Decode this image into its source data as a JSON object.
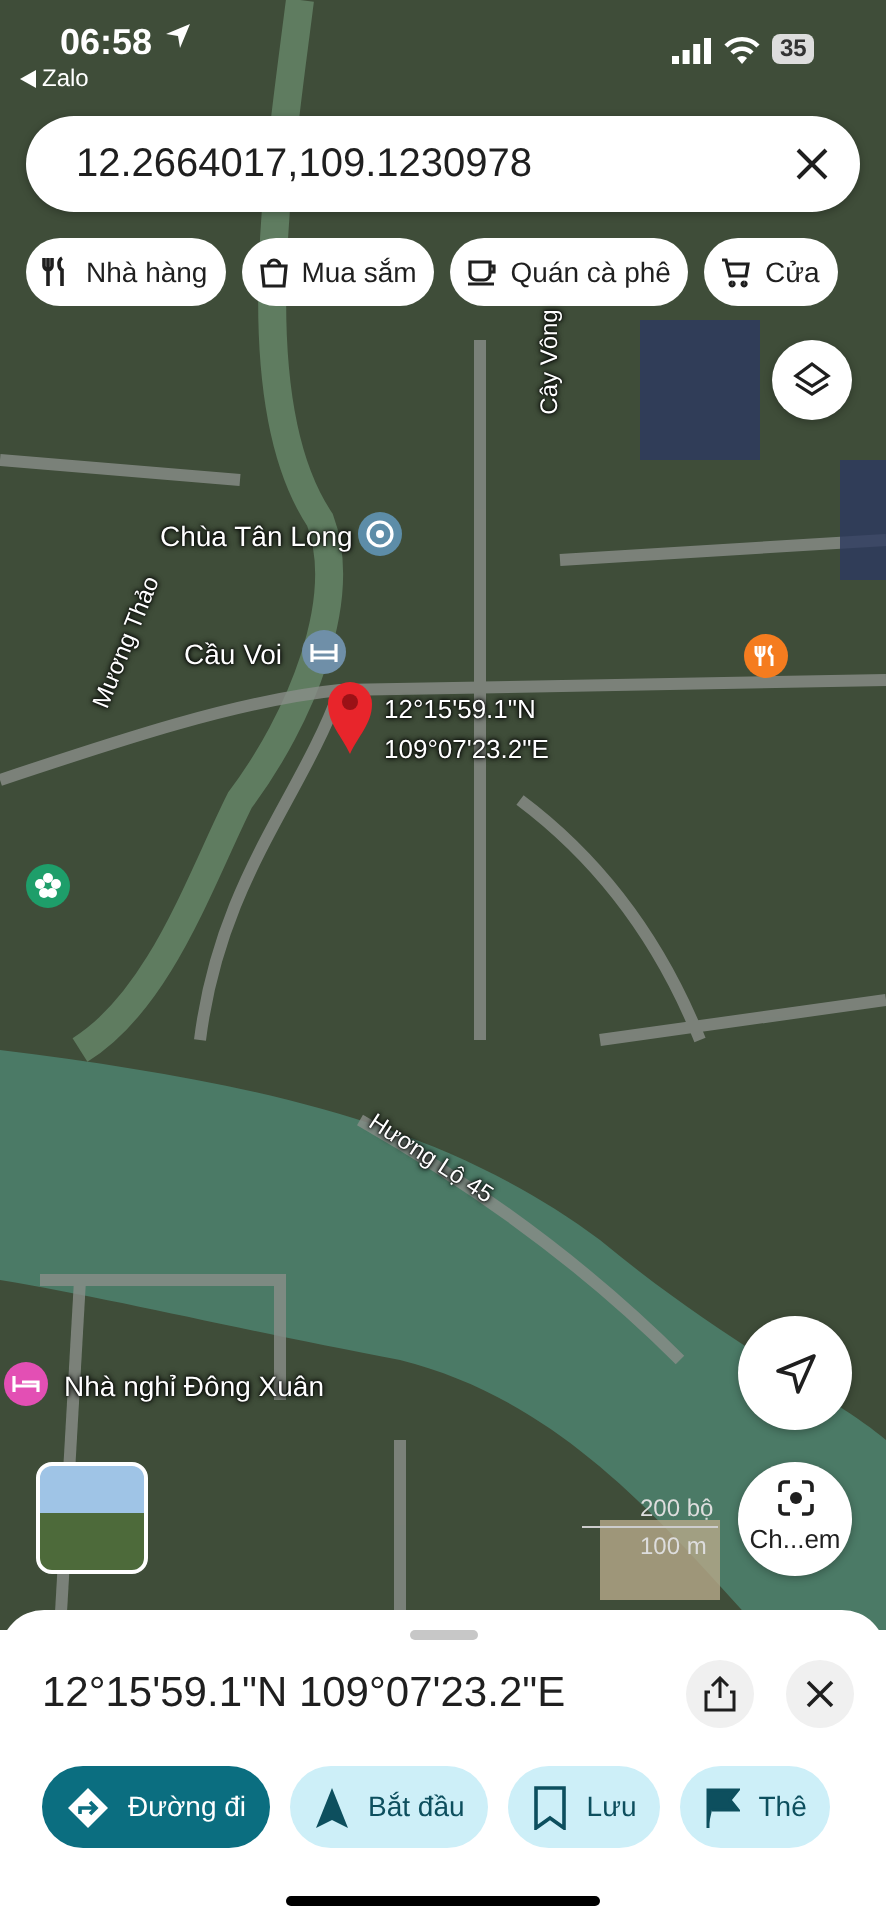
{
  "status_bar": {
    "time": "06:58",
    "back_app": "Zalo",
    "battery": "35"
  },
  "search": {
    "value": "12.2664017,109.1230978"
  },
  "chips": [
    {
      "label": "Nhà hàng",
      "kind": "restaurant"
    },
    {
      "label": "Mua sắm",
      "kind": "shopping"
    },
    {
      "label": "Quán cà phê",
      "kind": "cafe"
    },
    {
      "label": "Cửa",
      "kind": "store"
    }
  ],
  "map": {
    "places": [
      {
        "name": "Chùa Tân Long",
        "kind": "temple"
      },
      {
        "name": "Cầu Voi",
        "kind": "bridge"
      },
      {
        "name": "Nhà nghỉ Đông Xuân",
        "kind": "hotel"
      }
    ],
    "poi_pins": [
      {
        "kind": "restaurant",
        "color": "#f57c1f"
      },
      {
        "kind": "flower",
        "color": "#1e9e6a"
      }
    ],
    "roads": [
      {
        "name": "Mương Thảo"
      },
      {
        "name": "Cây Vông"
      },
      {
        "name": "Hương Lộ 45"
      }
    ],
    "dropped_pin": {
      "lines": [
        "12°15'59.1\"N",
        "109°07'23.2\"E"
      ]
    },
    "scale": [
      "200 bộ",
      "100 m"
    ],
    "lens_button": "Ch...em"
  },
  "sheet": {
    "title": "12°15'59.1\"N 109°07'23.2\"E",
    "actions": [
      {
        "label": "Đường đi",
        "kind": "directions",
        "primary": true
      },
      {
        "label": "Bắt đầu",
        "kind": "start",
        "primary": false
      },
      {
        "label": "Lưu",
        "kind": "save",
        "primary": false
      },
      {
        "label": "Thê",
        "kind": "flag",
        "primary": false
      }
    ]
  }
}
